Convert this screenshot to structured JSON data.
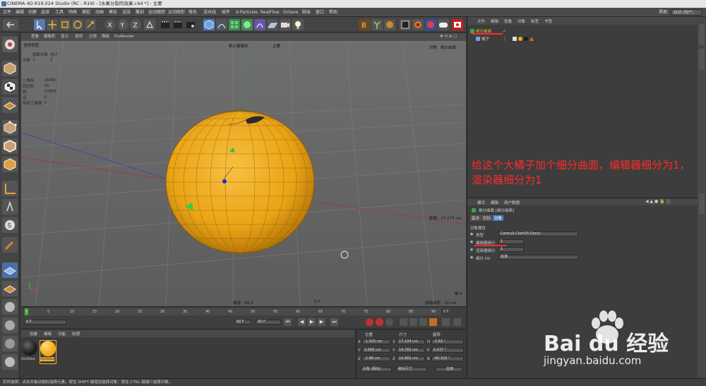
{
  "window": {
    "title": "CINEMA 4D R19.024 Studio (RC - R19) - [水果分裂的效果.c4d *] - 主要"
  },
  "menubar": {
    "items": [
      "文件",
      "编辑",
      "创建",
      "选择",
      "工具",
      "网格",
      "捕捉",
      "动画",
      "模拟",
      "渲染",
      "雕刻",
      "运动跟踪",
      "运动图形",
      "角色",
      "流水线",
      "插件",
      "X-Particles",
      "RealFlow",
      "Octane",
      "脚本",
      "窗口",
      "帮助"
    ],
    "interface_label": "界面:",
    "interface_value": "启动 (用户)"
  },
  "viewport": {
    "menu": [
      "查看",
      "摄像机",
      "显示",
      "选项",
      "过滤",
      "面板",
      "ProRender"
    ],
    "name": "透视视图",
    "camera_label": "默认摄像机",
    "camera_tag": "主要",
    "top_right_tabs": [
      "对象",
      "细分曲面"
    ],
    "hud_header": [
      "选取对象",
      "总计"
    ],
    "hud_object_row": [
      "对象",
      "1",
      "2"
    ],
    "stats": [
      {
        "label": "三角形",
        "value": "16060"
      },
      {
        "label": "四边形",
        "value": "15"
      },
      {
        "label": "线",
        "value": "17855"
      },
      {
        "label": "点",
        "value": "0"
      },
      {
        "label": "带状三角面",
        "value": "0"
      }
    ],
    "distance": "距离 : 27.277 cm",
    "fps": "帧速 : 65.2",
    "frame": "0 F",
    "grid": "网格间距 : 10 cm",
    "axis_label": "帧 0"
  },
  "timeline": {
    "ticks": [
      "0",
      "5",
      "10",
      "15",
      "20",
      "25",
      "30",
      "35",
      "40",
      "45",
      "50",
      "55",
      "60",
      "65",
      "70",
      "75",
      "80",
      "85",
      "90"
    ],
    "end_marker": "0 F",
    "start_field": "0 F",
    "end_field": "90 F",
    "end_field2": "90 F"
  },
  "materials": {
    "menu": [
      "创建",
      "编辑",
      "功能",
      "纹理"
    ],
    "items": [
      {
        "name": "OctGlos",
        "color": "#1c1c1c"
      },
      {
        "name": "OctGlos",
        "color": "#f2a81a"
      }
    ]
  },
  "coords": {
    "headers": [
      "位置",
      "尺寸",
      "旋转"
    ],
    "rows": [
      {
        "axis": "X",
        "pos": "-1.525 cm",
        "size_axis": "X",
        "size": "17.104 cm",
        "rot_axis": "H",
        "rot": "-3.63 °"
      },
      {
        "axis": "Y",
        "pos": "3.669 cm",
        "size_axis": "Y",
        "size": "14.782 cm",
        "rot_axis": "P",
        "rot": "0.037 °"
      },
      {
        "axis": "Z",
        "pos": "-2.88 cm",
        "size_axis": "Z",
        "size": "14.982 cm",
        "rot_axis": "B",
        "rot": "-90.316 °"
      }
    ],
    "mode1": "对象 (相对)",
    "mode2": "绝对尺寸",
    "apply": "应用"
  },
  "objects": {
    "menu": [
      "文件",
      "编辑",
      "查看",
      "对象",
      "标签",
      "书签"
    ],
    "rows": [
      {
        "name": "细分曲面"
      },
      {
        "name": "橘子"
      }
    ]
  },
  "attributes": {
    "menu": [
      "模式",
      "编辑",
      "用户数据"
    ],
    "title": "细分曲面 [细分曲面]",
    "tabs": [
      "基本",
      "坐标",
      "对象"
    ],
    "section": "对象属性",
    "fields": [
      {
        "label": "类型",
        "value": "Catmull-Clark(N-Gons)"
      },
      {
        "label": "编辑器细分",
        "value": "1"
      },
      {
        "label": "渲染器细分",
        "value": "1"
      },
      {
        "label": "细分 UV",
        "value": "标准"
      }
    ]
  },
  "annotation": "给这个大橘子加个细分曲面，编辑器细分为1，渲染器细分为1",
  "statusbar": "实时选择：点击并拖动鼠标选择元素。按住 SHIFT 键增加选择对象；按住 CTRL 键减少选择对象。",
  "watermark": {
    "brand": "Bai du 经验",
    "url": "jingyan.baidu.com"
  },
  "colors": {
    "orange": "#f2a81a",
    "accent_red": "#ff2a2a",
    "selection": "#4a7fc0"
  }
}
